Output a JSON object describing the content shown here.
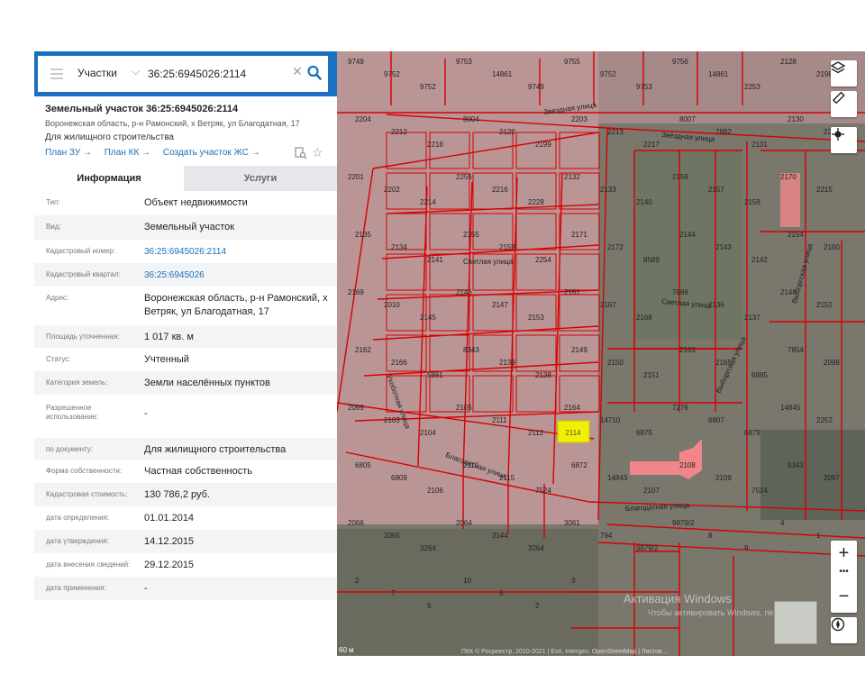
{
  "colors": {
    "accent": "#1b71c1",
    "link": "#1b6fb8",
    "boundary": "#d80000",
    "highlight": "#f2f000",
    "building": "#f0868a"
  },
  "search": {
    "layer_label": "Участки",
    "query": "36:25:6945026:2114"
  },
  "parcel": {
    "title": "Земельный участок 36:25:6945026:2114",
    "address": "Воронежская область, р-н Рамонский, х Ветряк, ул Благодатная, 17",
    "purpose": "Для жилищного строительства"
  },
  "links": [
    "План ЗУ →",
    "План КК →",
    "Создать участок ЖС →"
  ],
  "tabs": {
    "info": "Информация",
    "services": "Услуги"
  },
  "info_rows": [
    {
      "label": "Тип:",
      "value": "Объект недвижимости"
    },
    {
      "label": "Вид:",
      "value": "Земельный участок"
    },
    {
      "label": "Кадастровый номер:",
      "value": "36:25:6945026:2114",
      "link": true
    },
    {
      "label": "Кадастровый квартал:",
      "value": "36:25:6945026",
      "link": true
    },
    {
      "label": "Адрес:",
      "value": "Воронежская область, р-н Рамонский, х Ветряк, ул Благодатная, 17"
    },
    {
      "label": "Площадь уточненная:",
      "value": "1 017 кв. м"
    },
    {
      "label": "Статус:",
      "value": "Учтенный"
    },
    {
      "label": "Категория земель:",
      "value": "Земли населённых пунктов"
    },
    {
      "label": "Разрешенное использование:",
      "value": "-"
    },
    {
      "label": "по документу:",
      "value": "Для жилищного строительства"
    },
    {
      "label": "Форма собственности:",
      "value": "Частная собственность"
    },
    {
      "label": "Кадастровая стоимость:",
      "value": "130 786,2 руб."
    },
    {
      "label": "дата определения:",
      "value": "01.01.2014"
    },
    {
      "label": "дата утверждения:",
      "value": "14.12.2015"
    },
    {
      "label": "дата внесения сведений:",
      "value": "29.12.2015"
    },
    {
      "label": "дата применения:",
      "value": "-"
    }
  ],
  "map": {
    "selected_parcel": "2114",
    "streets": [
      "Звездная улица",
      "Звёздная улица",
      "Светлая улица",
      "Благодатная улица",
      "Выборгская улица",
      "Ухоботная улица",
      "Светлая улица",
      "Благодатная улица",
      "Выборгская улица"
    ],
    "parcel_labels": [
      "9749",
      "9752",
      "9752",
      "9753",
      "14861",
      "9749",
      "9755",
      "9752",
      "9753",
      "9756",
      "14861",
      "2253",
      "2128",
      "2198",
      "2204",
      "2212",
      "2218",
      "8004",
      "2129",
      "2199",
      "2203",
      "2213",
      "2217",
      "8007",
      "7882",
      "2131",
      "2130",
      "2200",
      "2201",
      "2202",
      "2214",
      "2255",
      "2216",
      "2228",
      "2132",
      "2133",
      "2140",
      "2156",
      "2157",
      "2158",
      "2170",
      "2215",
      "2135",
      "2134",
      "2141",
      "2155",
      "2159",
      "2254",
      "2171",
      "2172",
      "8589",
      "2144",
      "2143",
      "2142",
      "2154",
      "2160",
      "2169",
      "2010",
      "2145",
      "2146",
      "2147",
      "2153",
      "2161",
      "2167",
      "2168",
      "7886",
      "2136",
      "2137",
      "2148",
      "2152",
      "2162",
      "2166",
      "6881",
      "8343",
      "2139",
      "2138",
      "2149",
      "2150",
      "2151",
      "2163",
      "2165",
      "6885",
      "7854",
      "2098",
      "2099",
      "2103",
      "2104",
      "2105",
      "2111",
      "2112",
      "2164",
      "14710",
      "6875",
      "7276",
      "6807",
      "6879",
      "14845",
      "2252",
      "6805",
      "6809",
      "2106",
      "2110",
      "2115",
      "7524",
      "6872",
      "14843",
      "2107",
      "2108",
      "2109",
      "7524",
      "9343",
      "2067",
      "2066",
      "2065",
      "3264",
      "2064",
      "3144",
      "3264",
      "3061",
      "794",
      "9879/2",
      "9879/2",
      "8",
      "9",
      "4",
      "1",
      "2",
      "7",
      "5",
      "10",
      "6",
      "2",
      "3"
    ],
    "watermark": "Активация Windows",
    "watermark_sub": "Чтобы активировать Windows, перейдите",
    "scale": "60 м",
    "copyright": "ПКК © Росреестр, 2010-2021 | Esri, Intergeo, OpenStreetMap | Листов..."
  },
  "icons": [
    "menu-icon",
    "chevron-down-icon",
    "clear-icon",
    "search-icon",
    "chevron-left-icon",
    "document-search-icon",
    "star-icon",
    "layers-icon",
    "ruler-icon",
    "locate-icon",
    "zoom-in-icon",
    "zoom-out-icon",
    "compass-icon"
  ]
}
